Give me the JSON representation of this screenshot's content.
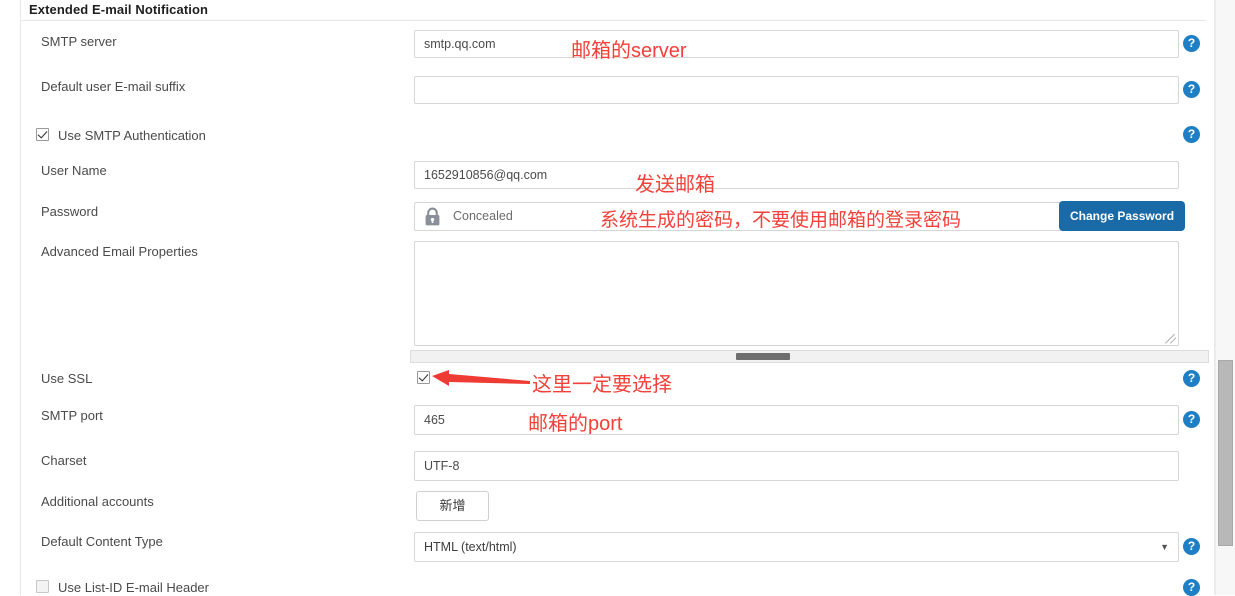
{
  "section": {
    "title": "Extended E-mail Notification"
  },
  "fields": {
    "smtp_server": {
      "label": "SMTP server",
      "value": "smtp.qq.com"
    },
    "default_suffix": {
      "label": "Default user E-mail suffix",
      "value": ""
    },
    "use_smtp_auth": {
      "label": "Use SMTP Authentication",
      "checked": true
    },
    "user_name": {
      "label": "User Name",
      "value": "1652910856@qq.com"
    },
    "password": {
      "label": "Password",
      "value": "Concealed",
      "button_label": "Change Password",
      "icon": "lock-icon"
    },
    "advanced_email_properties": {
      "label": "Advanced Email Properties",
      "value": ""
    },
    "use_ssl": {
      "label": "Use SSL",
      "checked": true
    },
    "smtp_port": {
      "label": "SMTP port",
      "value": "465"
    },
    "charset": {
      "label": "Charset",
      "value": "UTF-8"
    },
    "additional_accounts": {
      "label": "Additional accounts",
      "button_label": "新增"
    },
    "default_content_type": {
      "label": "Default Content Type",
      "value": "HTML (text/html)"
    },
    "use_list_id_header": {
      "label": "Use List-ID E-mail Header",
      "checked": false
    }
  },
  "annotations": {
    "server": "邮箱的server",
    "sender": "发送邮箱",
    "password": "系统生成的密码，不要使用邮箱的登录密码",
    "ssl": "这里一定要选择",
    "port": "邮箱的port",
    "color": "#f2403a"
  },
  "icons": {
    "help": "?"
  }
}
